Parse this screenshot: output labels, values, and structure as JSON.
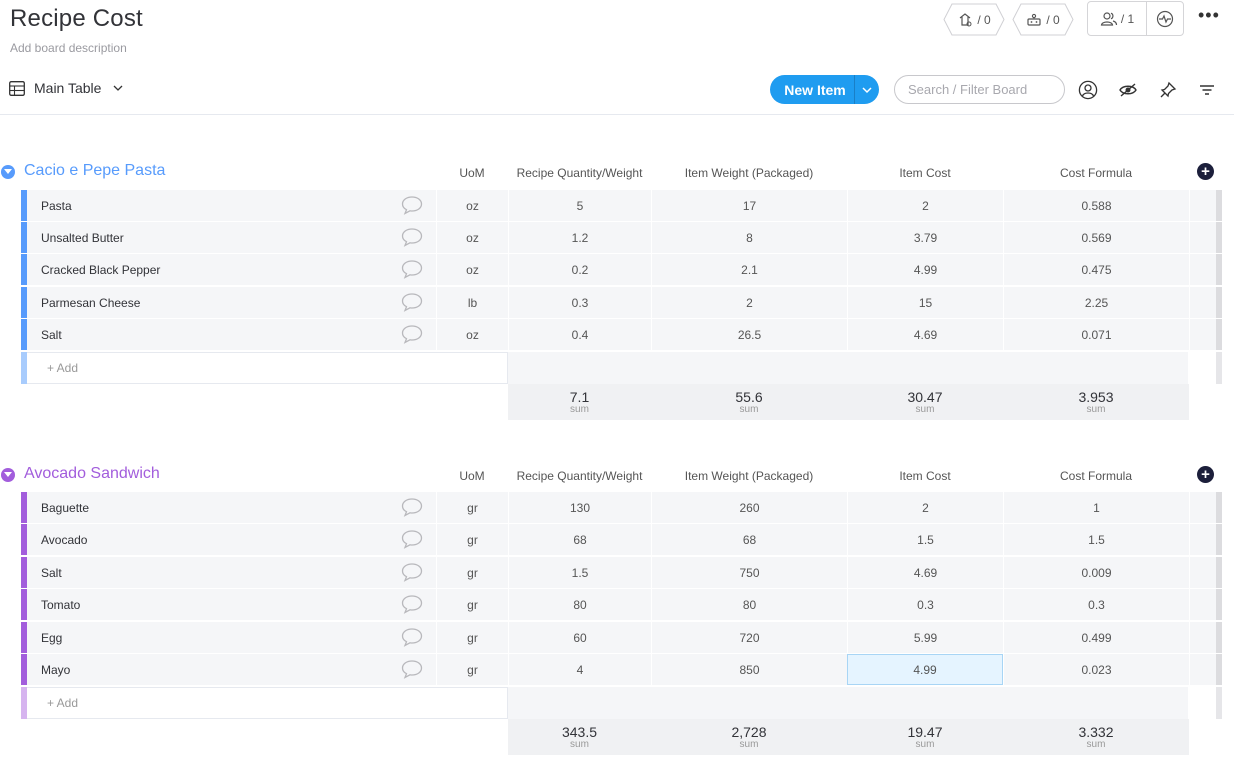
{
  "board": {
    "title": "Recipe Cost",
    "description": "Add board description"
  },
  "header": {
    "badge1": {
      "icon": "activity-icon",
      "count": "/ 0"
    },
    "badge2": {
      "icon": "integrations-icon",
      "count": "/ 0"
    },
    "persons": {
      "icon": "persons-icon",
      "count": "/ 1"
    },
    "activity_icon": "activity-log-icon",
    "more": "•••"
  },
  "toolbar": {
    "view_label": "Main Table",
    "new_item_label": "New Item",
    "search_placeholder": "Search / Filter Board"
  },
  "columns": [
    "UoM",
    "Recipe Quantity/Weight",
    "Item Weight (Packaged)",
    "Item Cost",
    "Cost Formula"
  ],
  "groups": [
    {
      "name": "Cacio e Pepe Pasta",
      "color": "#579bfc",
      "add_label": "+ Add",
      "items": [
        {
          "name": "Pasta",
          "uom": "oz",
          "qty": "5",
          "weight": "17",
          "cost": "2",
          "formula": "0.588"
        },
        {
          "name": "Unsalted Butter",
          "uom": "oz",
          "qty": "1.2",
          "weight": "8",
          "cost": "3.79",
          "formula": "0.569"
        },
        {
          "name": "Cracked Black Pepper",
          "uom": "oz",
          "qty": "0.2",
          "weight": "2.1",
          "cost": "4.99",
          "formula": "0.475"
        },
        {
          "name": "Parmesan Cheese",
          "uom": "lb",
          "qty": "0.3",
          "weight": "2",
          "cost": "15",
          "formula": "2.25"
        },
        {
          "name": "Salt",
          "uom": "oz",
          "qty": "0.4",
          "weight": "26.5",
          "cost": "4.69",
          "formula": "0.071"
        }
      ],
      "sums": {
        "qty": "7.1",
        "weight": "55.6",
        "cost": "30.47",
        "formula": "3.953",
        "label": "sum"
      }
    },
    {
      "name": "Avocado Sandwich",
      "color": "#a25ddc",
      "add_label": "+ Add",
      "items": [
        {
          "name": "Baguette",
          "uom": "gr",
          "qty": "130",
          "weight": "260",
          "cost": "2",
          "formula": "1"
        },
        {
          "name": "Avocado",
          "uom": "gr",
          "qty": "68",
          "weight": "68",
          "cost": "1.5",
          "formula": "1.5"
        },
        {
          "name": "Salt",
          "uom": "gr",
          "qty": "1.5",
          "weight": "750",
          "cost": "4.69",
          "formula": "0.009"
        },
        {
          "name": "Tomato",
          "uom": "gr",
          "qty": "80",
          "weight": "80",
          "cost": "0.3",
          "formula": "0.3"
        },
        {
          "name": "Egg",
          "uom": "gr",
          "qty": "60",
          "weight": "720",
          "cost": "5.99",
          "formula": "0.499"
        },
        {
          "name": "Mayo",
          "uom": "gr",
          "qty": "4",
          "weight": "850",
          "cost": "4.99",
          "formula": "0.023"
        }
      ],
      "sums": {
        "qty": "343.5",
        "weight": "2,728",
        "cost": "19.47",
        "formula": "3.332",
        "label": "sum"
      }
    }
  ]
}
